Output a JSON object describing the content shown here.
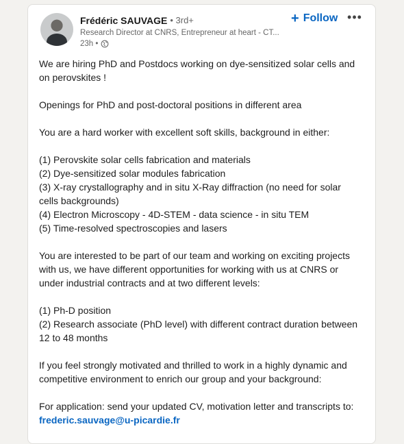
{
  "post": {
    "author": {
      "name": "Frédéric SAUVAGE",
      "degree": "• 3rd+",
      "headline": "Research Director at CNRS, Entrepreneur at heart - CT...",
      "time": "23h •"
    },
    "follow_label": "Follow",
    "more_label": "•••",
    "paragraphs": {
      "p1": "We are hiring PhD and Postdocs working on dye-sensitized solar cells and on perovskites !",
      "p2": "Openings for PhD and post-doctoral positions in different area",
      "p3": "You are a hard worker with excellent soft skills, background in either:",
      "list1": [
        "(1) Perovskite solar cells fabrication and materials",
        "(2) Dye-sensitized solar modules fabrication",
        "(3) X-ray crystallography and in situ X-Ray diffraction (no need for solar cells backgrounds)",
        "(4) Electron Microscopy - 4D-STEM - data science - in situ TEM",
        "(5) Time-resolved spectroscopies and lasers"
      ],
      "p4": "You are interested to be part of our team and working on exciting projects with us, we have different opportunities for working with us at CNRS or under industrial contracts and at two different levels:",
      "list2": [
        "(1) Ph-D position",
        "(2) Research associate (PhD level) with different contract duration between 12 to 48 months"
      ],
      "p5": "If you feel strongly motivated and thrilled to work in a highly dynamic and competitive environment to enrich our group and your background:",
      "p6": "For application: send your updated CV, motivation letter and transcripts to:",
      "email": "frederic.sauvage@u-picardie.fr"
    }
  },
  "colors": {
    "accent": "#0a66c2",
    "background": "#f3f2ef",
    "card": "#ffffff"
  },
  "icons": {
    "visibility": "globe-icon",
    "follow": "plus-icon",
    "more": "ellipsis-icon"
  }
}
